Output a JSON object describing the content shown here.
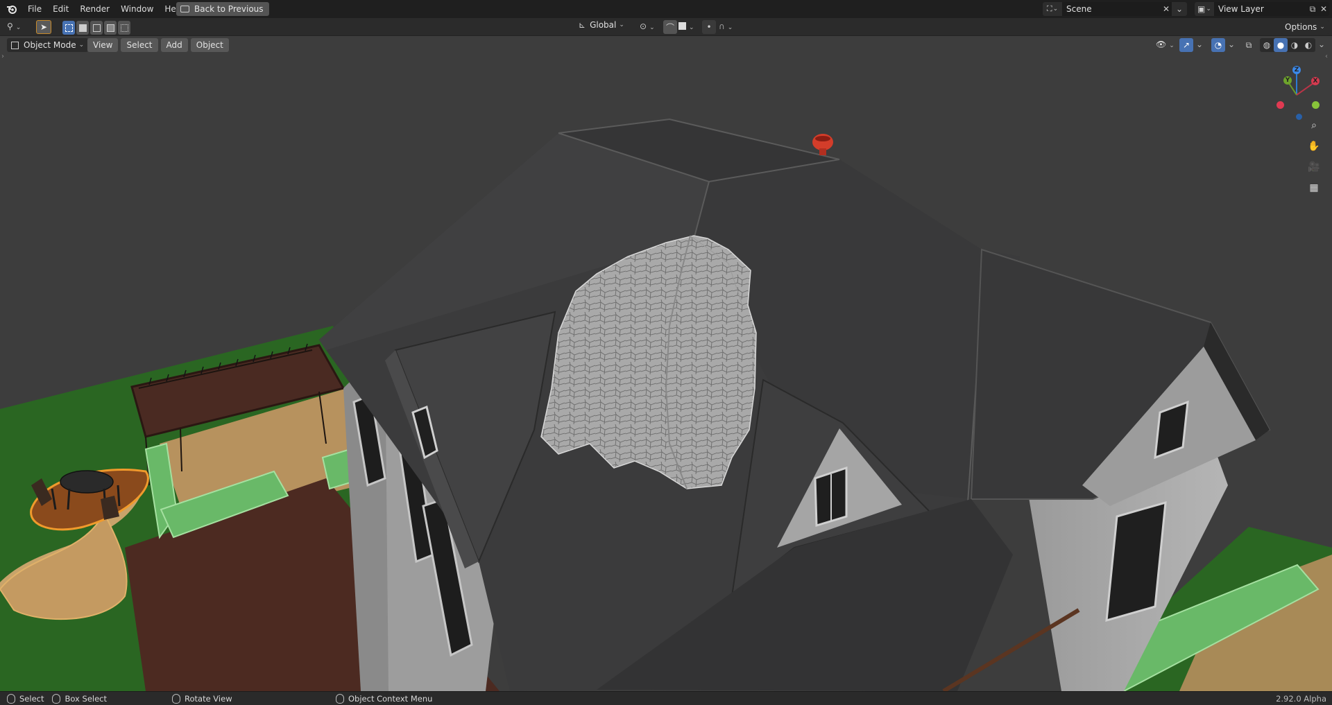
{
  "topbar": {
    "menus": [
      "File",
      "Edit",
      "Render",
      "Window",
      "Help"
    ],
    "back_button": "Back to Previous",
    "scene_field": "Scene",
    "view_layer_field": "View Layer"
  },
  "toolbar": {
    "transform_orientation": "Global",
    "options_label": "Options"
  },
  "viewport_header": {
    "mode": "Object Mode",
    "menus": [
      "View",
      "Select",
      "Add",
      "Object"
    ]
  },
  "gizmo": {
    "z": "Z",
    "y": "Y",
    "x": "X"
  },
  "statusbar": {
    "select": "Select",
    "box_select": "Box Select",
    "rotate_view": "Rotate View",
    "context_menu": "Object Context Menu",
    "version": "2.92.0 Alpha"
  },
  "colors": {
    "accent": "#4772b3",
    "roof": "#3a3a3b",
    "grass": "#2c6b25",
    "deck": "#4c2a21",
    "selection": "#f09a2c"
  }
}
